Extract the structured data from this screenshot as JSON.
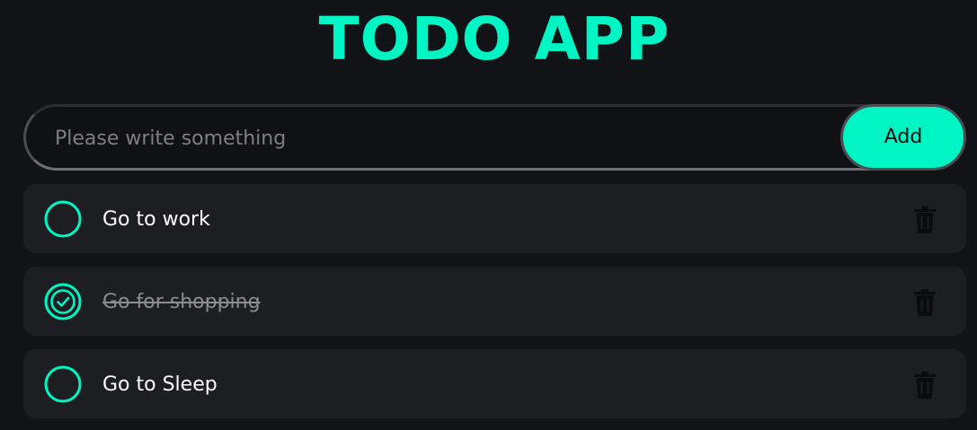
{
  "app": {
    "title": "TODO APP"
  },
  "input": {
    "placeholder": "Please write something",
    "value": ""
  },
  "add_button": {
    "label": "Add"
  },
  "todos": [
    {
      "text": "Go to work",
      "completed": false,
      "check_icon": "circle-icon",
      "delete_icon": "trash-icon"
    },
    {
      "text": "Go for shopping",
      "completed": true,
      "check_icon": "check-circle-icon",
      "delete_icon": "trash-icon"
    },
    {
      "text": "Go to Sleep",
      "completed": false,
      "check_icon": "circle-icon",
      "delete_icon": "trash-icon"
    }
  ],
  "colors": {
    "accent": "#00f5c4",
    "background": "#111317",
    "card": "#1c1e22",
    "text": "#ffffff",
    "completed_text": "#8a8d91",
    "trash": "#0b0c0e"
  }
}
